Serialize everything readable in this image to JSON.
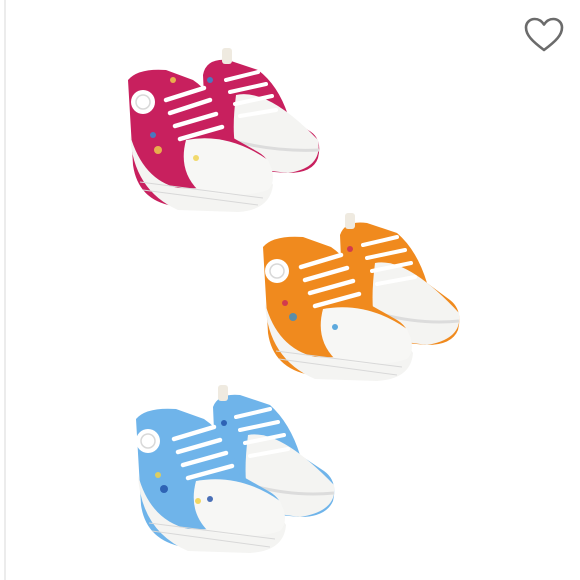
{
  "product_image": {
    "shoe_pairs": [
      {
        "name": "pink",
        "upper_color": "#c8205e"
      },
      {
        "name": "orange",
        "upper_color": "#f08a1e"
      },
      {
        "name": "blue",
        "upper_color": "#6fb4ea"
      }
    ],
    "sole_color": "#f4f4f2",
    "lace_color": "#ffffff"
  },
  "wishlist": {
    "icon": "heart-icon",
    "stroke_color": "#6b6b6b"
  }
}
